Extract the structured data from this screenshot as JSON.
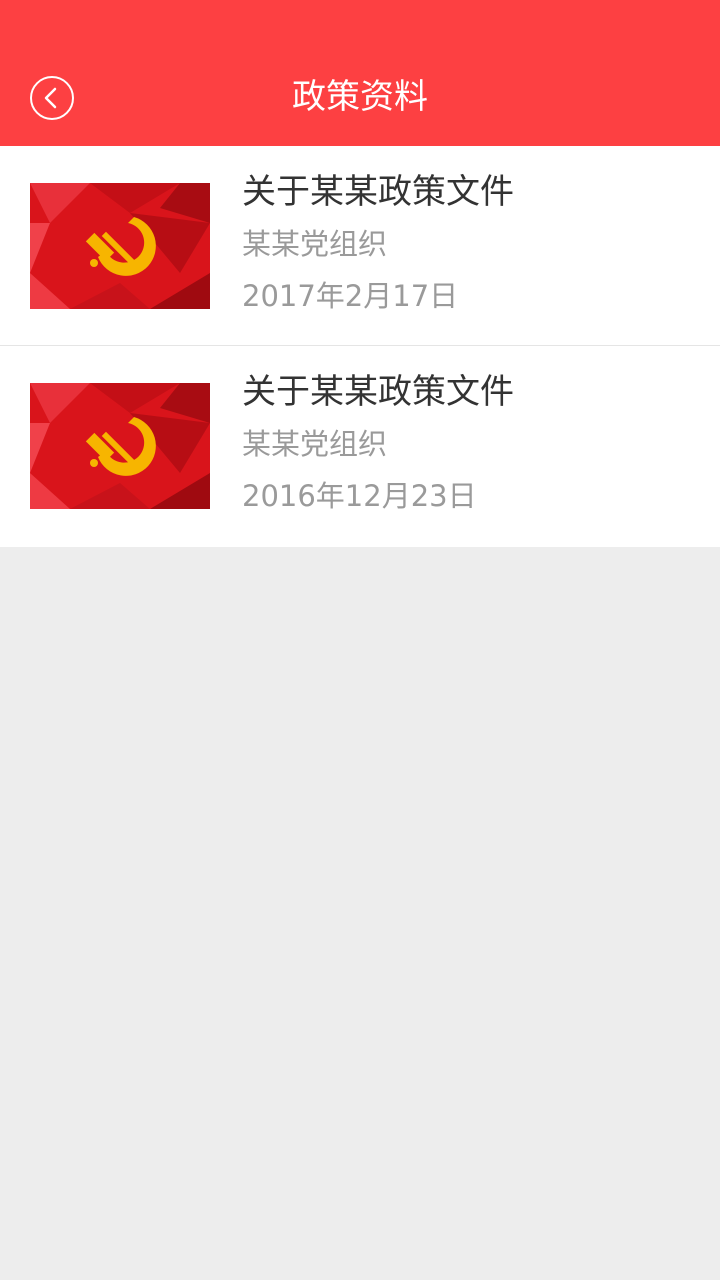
{
  "header": {
    "title": "政策资料",
    "background_color": "#fd4042",
    "back_icon": "chevron-left-icon"
  },
  "list": {
    "items": [
      {
        "title": "关于某某政策文件",
        "org": "某某党组织",
        "date": "2017年2月17日",
        "thumbnail_icon": "party-emblem-icon"
      },
      {
        "title": "关于某某政策文件",
        "org": "某某党组织",
        "date": "2016年12月23日",
        "thumbnail_icon": "party-emblem-icon"
      }
    ]
  },
  "colors": {
    "page_background": "#ededed",
    "title_text": "#333333",
    "secondary_text": "#9a9a9a"
  }
}
